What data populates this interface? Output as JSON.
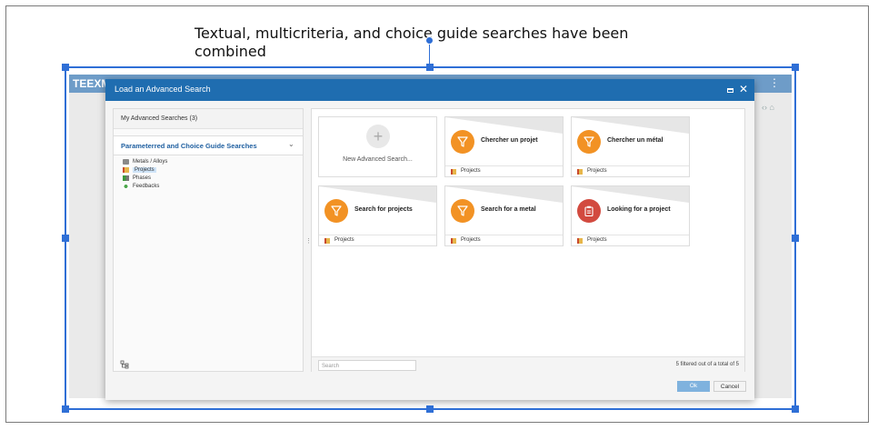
{
  "caption": "Textual, multicriteria, and choice guide searches have been combined",
  "background_app": {
    "logo": "TEEXM",
    "kebab": "⋮",
    "icons": "‹›  ⌂"
  },
  "dialog": {
    "title": "Load an Advanced Search",
    "maximize_label": "□",
    "close_label": "✕",
    "my_searches": "My Advanced Searches (3)",
    "param_section": "Parameterred and Choice Guide Searches",
    "tree": [
      {
        "label": "Metals / Alloys",
        "icon": "barrel-icon"
      },
      {
        "label": "Projects",
        "icon": "folder-icon",
        "selected": true
      },
      {
        "label": "Phases",
        "icon": "phases-icon"
      },
      {
        "label": "Feedbacks",
        "icon": "feedback-icon"
      }
    ],
    "cards": [
      {
        "title": "New Advanced Search...",
        "type": "new"
      },
      {
        "title": "Chercher un projet",
        "category": "Projects",
        "color": "#f29224",
        "icon": "funnel-icon"
      },
      {
        "title": "Chercher un métal",
        "category": "Projects",
        "color": "#f29224",
        "icon": "funnel-icon"
      },
      {
        "title": "Search for projects",
        "category": "Projects",
        "color": "#f29224",
        "icon": "funnel-icon"
      },
      {
        "title": "Search for a metal",
        "category": "Projects",
        "color": "#f29224",
        "icon": "funnel-icon"
      },
      {
        "title": "Looking for a project",
        "category": "Projects",
        "color": "#d24a3f",
        "icon": "clipboard-icon"
      }
    ],
    "search_placeholder": "Search",
    "filter_status": "5 filtered out of a total of 5",
    "ok_label": "Ok",
    "cancel_label": "Cancel"
  }
}
